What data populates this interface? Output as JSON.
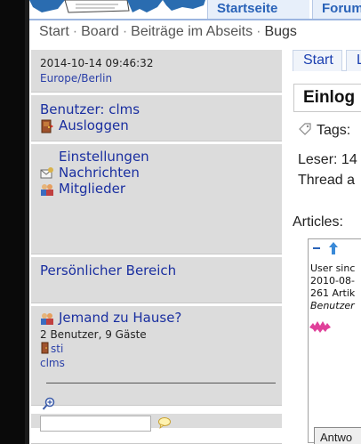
{
  "header": {
    "nav_tabs": [
      "Startseite",
      "Forum"
    ]
  },
  "breadcrumb": {
    "items": [
      "Start",
      "Board",
      "Beiträge im Abseits",
      "Bugs"
    ],
    "separator": "·"
  },
  "sidebar": {
    "datetime": "2014-10-14 09:46:32",
    "timezone": "Europe/Berlin",
    "user_label": "Benutzer: clms",
    "logout_label": "Ausloggen",
    "menu_items": [
      "Einstellungen",
      "Nachrichten",
      "Mitglieder"
    ],
    "personal_area": "Persönlicher Bereich",
    "who_is_home": "Jemand zu Hause?",
    "online_count": "2 Benutzer, 9 Gäste",
    "online_users": [
      "sti",
      "clms"
    ]
  },
  "main": {
    "tabs": [
      "Start",
      "L"
    ],
    "heading": "Einlog",
    "tags_label": "Tags:",
    "readers_label": "Leser: 14",
    "thread_label": "Thread a",
    "articles_label": "Articles:",
    "article_user_since": "User sinc",
    "article_date": "2010-08-",
    "article_count": "261 Artik",
    "article_role": "Benutzer",
    "reply_button": "Antwo"
  },
  "colors": {
    "nav_text": "#2a63b8",
    "link": "#1a2fa0",
    "sidebar_bg": "#dcdcdc",
    "edge": "#0a0a0a"
  }
}
